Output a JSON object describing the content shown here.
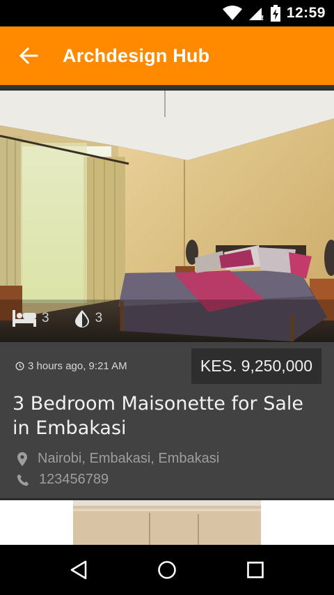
{
  "status_bar": {
    "time": "12:59",
    "icons": [
      "wifi-icon",
      "signal-icon",
      "battery-icon"
    ]
  },
  "app_bar": {
    "title": "Archdesign Hub",
    "back_icon": "arrow-left-icon",
    "background": "#ff8a00"
  },
  "listing": {
    "photo_description": "",
    "bedrooms": "3",
    "bathrooms": "3",
    "bed_icon": "bed-icon",
    "bath_icon": "water-drop-icon",
    "posted": "3 hours ago, 9:21 AM",
    "clock_icon": "clock-icon",
    "price": "KES. 9,250,000",
    "title": "3 Bedroom Maisonette for Sale in Embakasi",
    "location": "Nairobi, Embakasi, Embakasi",
    "location_icon": "location-pin-icon",
    "phone": "123456789",
    "phone_icon": "phone-icon"
  },
  "nav_bar": {
    "buttons": [
      "back-triangle-icon",
      "home-circle-icon",
      "recents-square-icon"
    ]
  }
}
